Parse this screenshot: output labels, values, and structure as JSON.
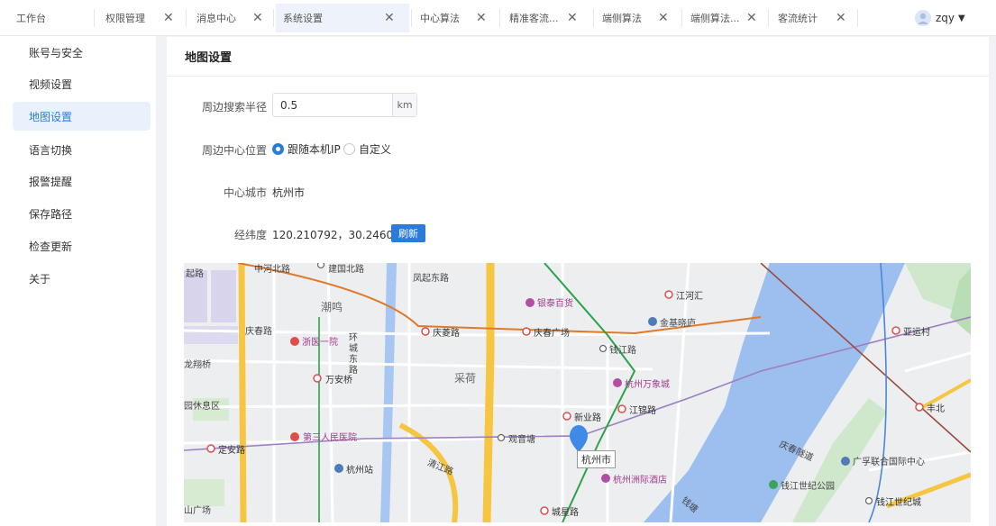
{
  "tabs": [
    {
      "label": "工作台",
      "closable": false
    },
    {
      "label": "权限管理",
      "closable": true
    },
    {
      "label": "消息中心",
      "closable": true
    },
    {
      "label": "系统设置",
      "closable": true,
      "active": true
    },
    {
      "label": "中心算法",
      "closable": true
    },
    {
      "label": "精准客流...",
      "closable": true
    },
    {
      "label": "端侧算法",
      "closable": true
    },
    {
      "label": "端侧算法...",
      "closable": true
    },
    {
      "label": "客流统计",
      "closable": true
    }
  ],
  "tab_close_glyph": "✕",
  "user": {
    "name": "zqy",
    "caret": "▼",
    "avatar_icon": "avatar-icon"
  },
  "sidebar": {
    "items": [
      {
        "label": "账号与安全"
      },
      {
        "label": "视频设置"
      },
      {
        "label": "地图设置",
        "active": true
      },
      {
        "label": "语言切换"
      },
      {
        "label": "报警提醒"
      },
      {
        "label": "保存路径"
      },
      {
        "label": "检查更新"
      },
      {
        "label": "关于"
      }
    ]
  },
  "panel": {
    "title": "地图设置",
    "radius": {
      "label": "周边搜索半径",
      "value": "0.5",
      "unit": "km"
    },
    "center_position": {
      "label": "周边中心位置",
      "options": [
        {
          "label": "跟随本机IP",
          "checked": true
        },
        {
          "label": "自定义",
          "checked": false
        }
      ]
    },
    "center_city": {
      "label": "中心城市",
      "value": "杭州市"
    },
    "coordinates": {
      "label": "经纬度",
      "value": "120.210792，30.246026",
      "refresh_label": "刷新"
    }
  },
  "map": {
    "marker_label": "杭州市",
    "labels": [
      {
        "text": "起路",
        "kind": "road"
      },
      {
        "text": "中河北路",
        "kind": "road"
      },
      {
        "text": "建国北路",
        "kind": "road"
      },
      {
        "text": "凤起东路",
        "kind": "road"
      },
      {
        "text": "银泰百货",
        "kind": "poi"
      },
      {
        "text": "江河汇",
        "kind": "station"
      },
      {
        "text": "潮鸣",
        "kind": "big"
      },
      {
        "text": "金基晓庐",
        "kind": "road"
      },
      {
        "text": "亚运村",
        "kind": "station"
      },
      {
        "text": "庆春路",
        "kind": "road"
      },
      {
        "text": "浙医一院",
        "kind": "poi"
      },
      {
        "text": "庆菱路",
        "kind": "station"
      },
      {
        "text": "庆春广场",
        "kind": "station"
      },
      {
        "text": "钱江路",
        "kind": "station"
      },
      {
        "text": "环城东路",
        "kind": "road"
      },
      {
        "text": "龙翔桥",
        "kind": "road"
      },
      {
        "text": "万安桥",
        "kind": "station"
      },
      {
        "text": "采荷",
        "kind": "big"
      },
      {
        "text": "杭州万象城",
        "kind": "poi"
      },
      {
        "text": "园休息区",
        "kind": "road"
      },
      {
        "text": "新业路",
        "kind": "station"
      },
      {
        "text": "江锦路",
        "kind": "station"
      },
      {
        "text": "丰北",
        "kind": "station"
      },
      {
        "text": "第三人民医院",
        "kind": "poi"
      },
      {
        "text": "观音塘",
        "kind": "station"
      },
      {
        "text": "定安路",
        "kind": "station"
      },
      {
        "text": "杭州站",
        "kind": "station"
      },
      {
        "text": "清江路",
        "kind": "road"
      },
      {
        "text": "庆春隧道",
        "kind": "road"
      },
      {
        "text": "广孚联合国际中心",
        "kind": "road"
      },
      {
        "text": "杭州洲际酒店",
        "kind": "poi"
      },
      {
        "text": "钱江世纪公园",
        "kind": "road"
      },
      {
        "text": "钱江世纪城",
        "kind": "station"
      },
      {
        "text": "山广场",
        "kind": "road"
      },
      {
        "text": "城星路",
        "kind": "station"
      },
      {
        "text": "钱塘",
        "kind": "road"
      }
    ]
  }
}
